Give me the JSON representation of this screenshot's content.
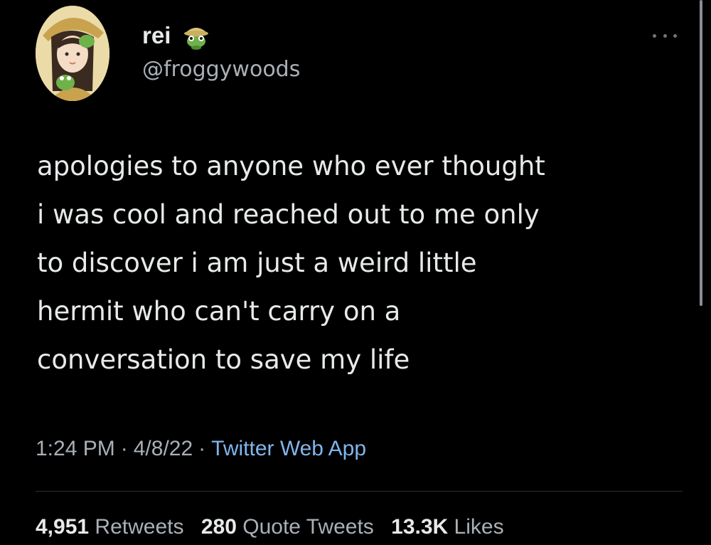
{
  "author": {
    "display_name": "rei",
    "handle": "@froggywoods",
    "avatar_icon": "avatar-illustration",
    "badge_icon": "frog-emoji"
  },
  "tweet": {
    "lines": [
      "apologies to anyone who ever thought",
      "i was cool and reached out to me only",
      "to discover i am just a weird little",
      "hermit who can't carry on a",
      "conversation to save my life"
    ],
    "time": "1:24 PM",
    "date": "4/8/22",
    "source": "Twitter Web App"
  },
  "stats": {
    "retweets_count": "4,951",
    "retweets_label": "Retweets",
    "quotes_count": "280",
    "quotes_label": "Quote Tweets",
    "likes_count": "13.3K",
    "likes_label": "Likes"
  },
  "colors": {
    "background": "#000000",
    "text": "#e7e9ea",
    "secondary_text": "#a9b0b6",
    "link": "#7fb6ec"
  }
}
